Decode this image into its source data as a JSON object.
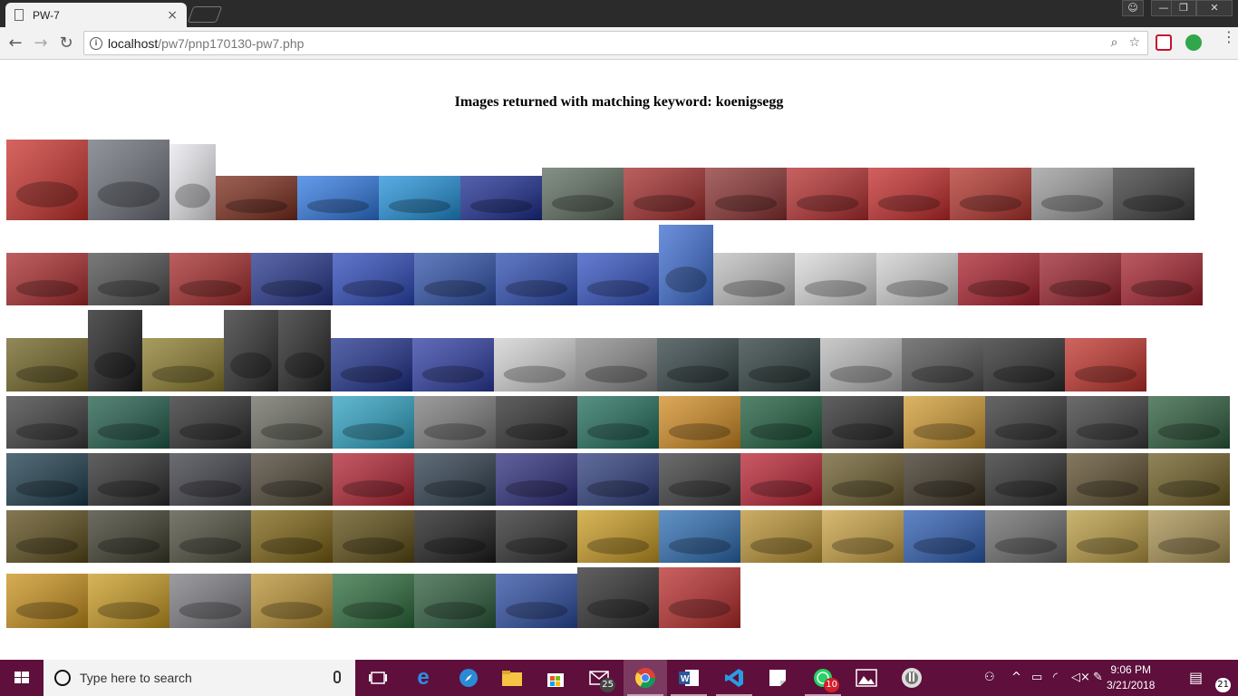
{
  "browser": {
    "tab_title": "PW-7",
    "tab_close": "×",
    "url_host": "localhost",
    "url_path": "/pw7/pnp170130-pw7.php",
    "window_controls": {
      "minimize": "—",
      "restore": "❐",
      "close": "✕"
    }
  },
  "page": {
    "heading": "Images returned with matching keyword: koenigsegg",
    "image_rows": [
      {
        "row": 1,
        "count": 15
      },
      {
        "row": 2,
        "count": 15
      },
      {
        "row": 3,
        "count": 15
      },
      {
        "row": 4,
        "count": 15
      },
      {
        "row": 5,
        "count": 15
      },
      {
        "row": 6,
        "count": 15
      },
      {
        "row": 7,
        "count": 9
      }
    ]
  },
  "taskbar": {
    "search_placeholder": "Type here to search",
    "mail_badge": "25",
    "whatsapp_badge": "10",
    "time": "9:06 PM",
    "date": "3/21/2018",
    "notification_badge": "21"
  },
  "colors": {
    "taskbar": "#5e0f3c",
    "titlebar": "#2b2b2b",
    "toolbar": "#f2f2f2"
  }
}
